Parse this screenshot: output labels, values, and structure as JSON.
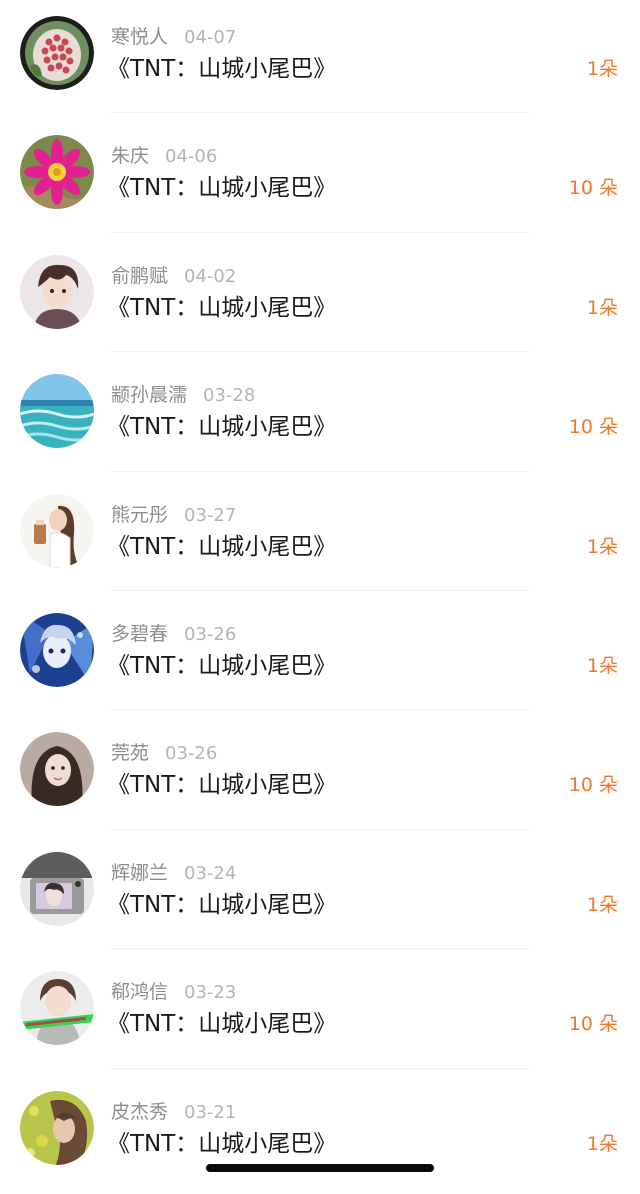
{
  "records": [
    {
      "name": "寒悦人",
      "date": "04-07",
      "title": "《TNT：山城小尾巴》",
      "gift": "1朵",
      "avatar": "flower-carving-avatar"
    },
    {
      "name": "朱庆",
      "date": "04-06",
      "title": "《TNT：山城小尾巴》",
      "gift": "10 朵",
      "avatar": "pink-flower-avatar"
    },
    {
      "name": "俞鹏赋",
      "date": "04-02",
      "title": "《TNT：山城小尾巴》",
      "gift": "1朵",
      "avatar": "anime-boy-avatar"
    },
    {
      "name": "颛孙晨濡",
      "date": "03-28",
      "title": "《TNT：山城小尾巴》",
      "gift": "10 朵",
      "avatar": "ocean-avatar"
    },
    {
      "name": "熊元彤",
      "date": "03-27",
      "title": "《TNT：山城小尾巴》",
      "gift": "1朵",
      "avatar": "girl-cup-avatar"
    },
    {
      "name": "多碧春",
      "date": "03-26",
      "title": "《TNT：山城小尾巴》",
      "gift": "1朵",
      "avatar": "anime-character-avatar"
    },
    {
      "name": "莞苑",
      "date": "03-26",
      "title": "《TNT：山城小尾巴》",
      "gift": "10 朵",
      "avatar": "girl-portrait-avatar"
    },
    {
      "name": "辉娜兰",
      "date": "03-24",
      "title": "《TNT：山城小尾巴》",
      "gift": "1朵",
      "avatar": "camera-avatar"
    },
    {
      "name": "郗鸿信",
      "date": "03-23",
      "title": "《TNT：山城小尾巴》",
      "gift": "10 朵",
      "avatar": "boy-caption-avatar"
    },
    {
      "name": "皮杰秀",
      "date": "03-21",
      "title": "《TNT：山城小尾巴》",
      "gift": "1朵",
      "avatar": "girl-field-avatar"
    }
  ],
  "colors": {
    "name": "#8e8e8e",
    "date": "#b4b4b4",
    "title": "#1a1a1a",
    "gift": "#f0782d",
    "divider": "#f2f2f2"
  }
}
